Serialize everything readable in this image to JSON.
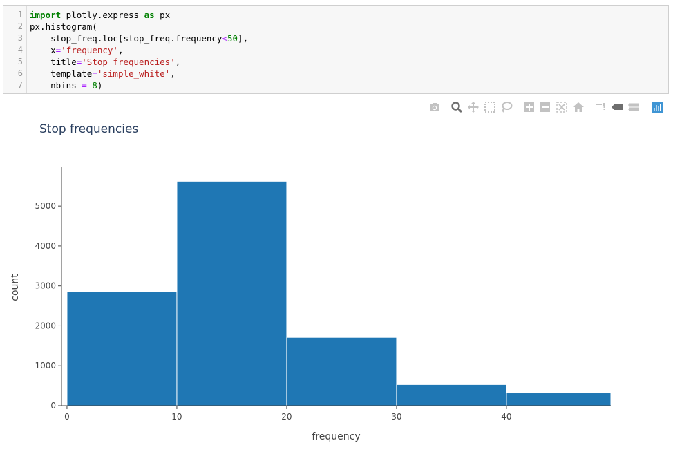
{
  "code_cell": {
    "line_numbers": [
      "1",
      "2",
      "3",
      "4",
      "5",
      "6",
      "7"
    ],
    "lines": [
      [
        {
          "t": "import",
          "c": "kw"
        },
        {
          "t": " plotly.express ",
          "c": ""
        },
        {
          "t": "as",
          "c": "kw"
        },
        {
          "t": " px",
          "c": ""
        }
      ],
      [
        {
          "t": "px.histogram(",
          "c": ""
        }
      ],
      [
        {
          "t": "    stop_freq.loc[stop_freq.frequency",
          "c": ""
        },
        {
          "t": "<",
          "c": "op"
        },
        {
          "t": "50",
          "c": "num"
        },
        {
          "t": "],",
          "c": ""
        }
      ],
      [
        {
          "t": "    x",
          "c": ""
        },
        {
          "t": "=",
          "c": "op"
        },
        {
          "t": "'frequency'",
          "c": "str"
        },
        {
          "t": ",",
          "c": ""
        }
      ],
      [
        {
          "t": "    title",
          "c": ""
        },
        {
          "t": "=",
          "c": "op"
        },
        {
          "t": "'Stop frequencies'",
          "c": "str"
        },
        {
          "t": ",",
          "c": ""
        }
      ],
      [
        {
          "t": "    template",
          "c": ""
        },
        {
          "t": "=",
          "c": "op"
        },
        {
          "t": "'simple_white'",
          "c": "str"
        },
        {
          "t": ",",
          "c": ""
        }
      ],
      [
        {
          "t": "    nbins ",
          "c": ""
        },
        {
          "t": "=",
          "c": "op"
        },
        {
          "t": " ",
          "c": ""
        },
        {
          "t": "8",
          "c": "num"
        },
        {
          "t": ")",
          "c": ""
        }
      ]
    ]
  },
  "modebar": {
    "icons": [
      "camera-icon",
      "zoom-icon",
      "pan-icon",
      "box-select-icon",
      "lasso-select-icon",
      "zoom-in-icon",
      "zoom-out-icon",
      "autoscale-icon",
      "reset-axes-icon",
      "spike-lines-icon",
      "hover-closest-icon",
      "hover-compare-icon",
      "plotly-logo-icon"
    ]
  },
  "colors": {
    "bar": "#1f77b4",
    "bar_edge": "#ffffff",
    "axis": "#444444",
    "title": "#2a3f5f",
    "modebar_icon": "#c2c2c2",
    "modebar_active": "#6e6e6e",
    "plotly_logo": "#3f95d4"
  },
  "chart_data": {
    "type": "bar",
    "title": "Stop frequencies",
    "xlabel": "frequency",
    "ylabel": "count",
    "bins": [
      {
        "start": 0,
        "end": 10,
        "count": 2860
      },
      {
        "start": 10,
        "end": 20,
        "count": 5620
      },
      {
        "start": 20,
        "end": 30,
        "count": 1710
      },
      {
        "start": 30,
        "end": 40,
        "count": 530
      },
      {
        "start": 40,
        "end": 50,
        "count": 320
      }
    ],
    "xlim": [
      -0.5,
      49.5
    ],
    "ylim": [
      0,
      5920
    ],
    "xticks": [
      0,
      10,
      20,
      30,
      40
    ],
    "xtick_labels": [
      "0",
      "10",
      "20",
      "30",
      "40"
    ],
    "yticks": [
      0,
      1000,
      2000,
      3000,
      4000,
      5000
    ],
    "ytick_labels": [
      "0",
      "1000",
      "2000",
      "3000",
      "4000",
      "5000"
    ],
    "grid": false,
    "legend": "none"
  }
}
